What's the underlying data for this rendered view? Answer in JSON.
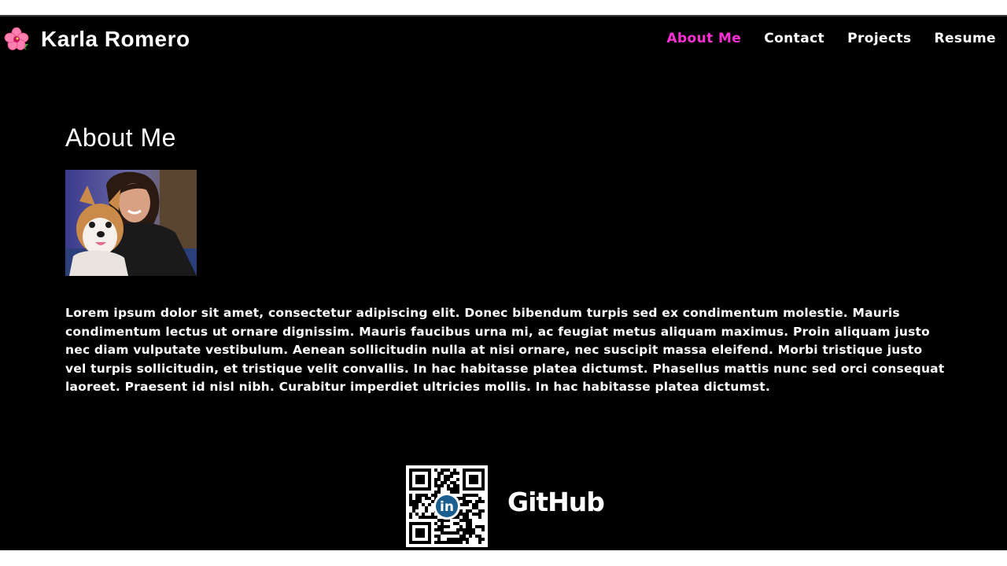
{
  "header": {
    "logo_icon": "hibiscus-flower-icon",
    "title": "Karla Romero",
    "nav": [
      {
        "label": "About Me",
        "active": true
      },
      {
        "label": "Contact",
        "active": false
      },
      {
        "label": "Projects",
        "active": false
      },
      {
        "label": "Resume",
        "active": false
      }
    ]
  },
  "main": {
    "heading": "About Me",
    "photo_alt": "Karla with her corgi",
    "bio": "Lorem ipsum dolor sit amet, consectetur adipiscing elit. Donec bibendum turpis sed ex condimentum molestie. Mauris condimentum lectus ut ornare dignissim. Mauris faucibus urna mi, ac feugiat metus aliquam maximus. Proin aliquam justo nec diam vulputate vestibulum. Aenean sollicitudin nulla at nisi ornare, nec suscipit massa eleifend. Morbi tristique justo vel turpis sollicitudin, et tristique velit convallis. In hac habitasse platea dictumst. Phasellus mattis nunc sed orci consequat laoreet. Praesent id nisl nibh. Curabitur imperdiet ultricies mollis. In hac habitasse platea dictumst."
  },
  "footer": {
    "qr_icon": "linkedin-qr-code",
    "qr_badge_text": "in",
    "github_label": "GitHub"
  },
  "colors": {
    "background": "#000000",
    "text": "#ffffff",
    "accent": "#ff2fd6",
    "linkedin": "#1a5f8f"
  }
}
